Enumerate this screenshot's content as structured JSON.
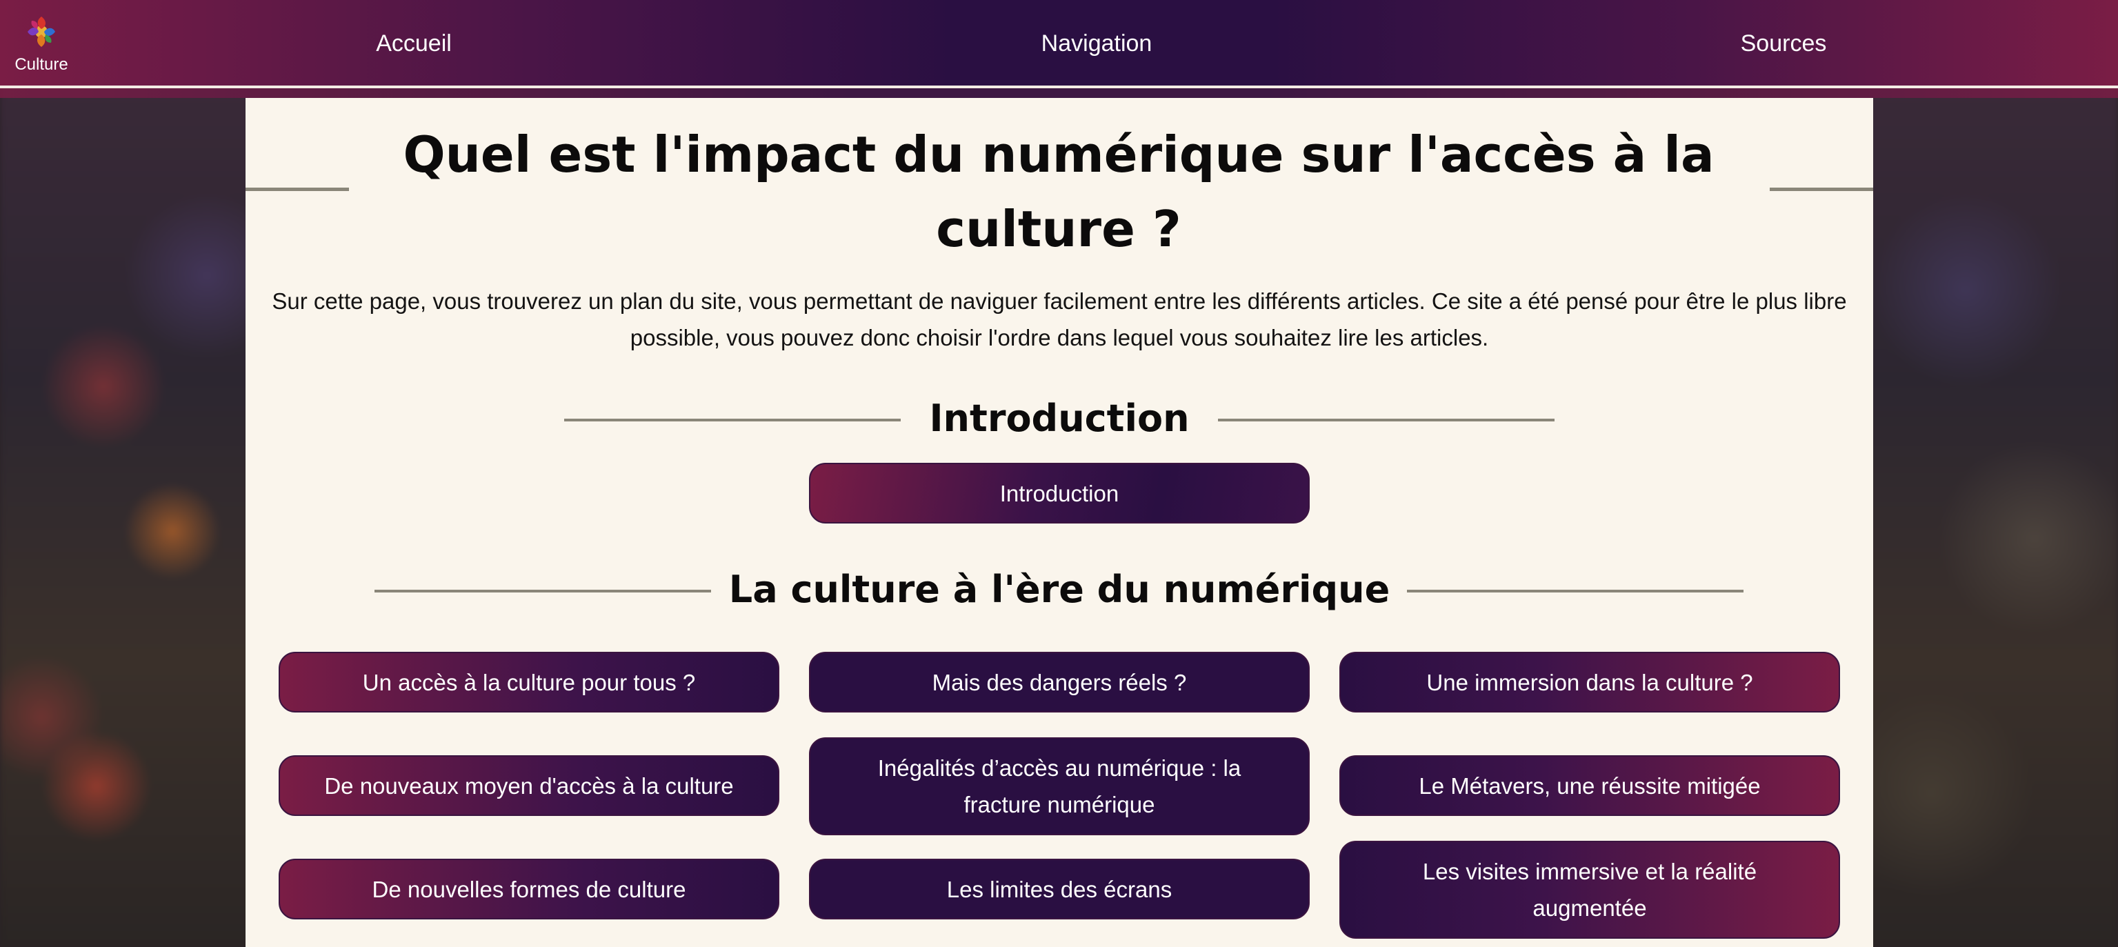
{
  "header": {
    "logo_text": "Culture",
    "nav": [
      "Accueil",
      "Navigation",
      "Sources"
    ]
  },
  "page": {
    "title": "Quel est l'impact du numérique sur l'accès à la culture ?",
    "intro": "Sur cette page, vous trouverez un plan du site, vous permettant de naviguer facilement entre les différents articles. Ce site a été pensé pour être le plus libre possible, vous pouvez donc choisir l'ordre dans lequel vous souhaitez lire les articles."
  },
  "sections": [
    {
      "heading": "Introduction",
      "buttons": [
        "Introduction"
      ]
    },
    {
      "heading": "La culture à l'ère du numérique",
      "columns": [
        [
          "Un accès à la culture pour tous ?",
          "De nouveaux moyen d'accès à la culture",
          "De nouvelles formes de culture"
        ],
        [
          "Mais des dangers réels ?",
          "Inégalités d’accès au numérique : la fracture numérique",
          "Les limites des écrans"
        ],
        [
          "Une immersion dans la culture ?",
          "Le Métavers, une réussite mitigée",
          "Les visites immersive et la réalité augmentée"
        ]
      ]
    }
  ],
  "colors": {
    "accent_magenta": "#7a1d45",
    "accent_indigo": "#2a0f42",
    "panel_background": "#faf5ec"
  }
}
